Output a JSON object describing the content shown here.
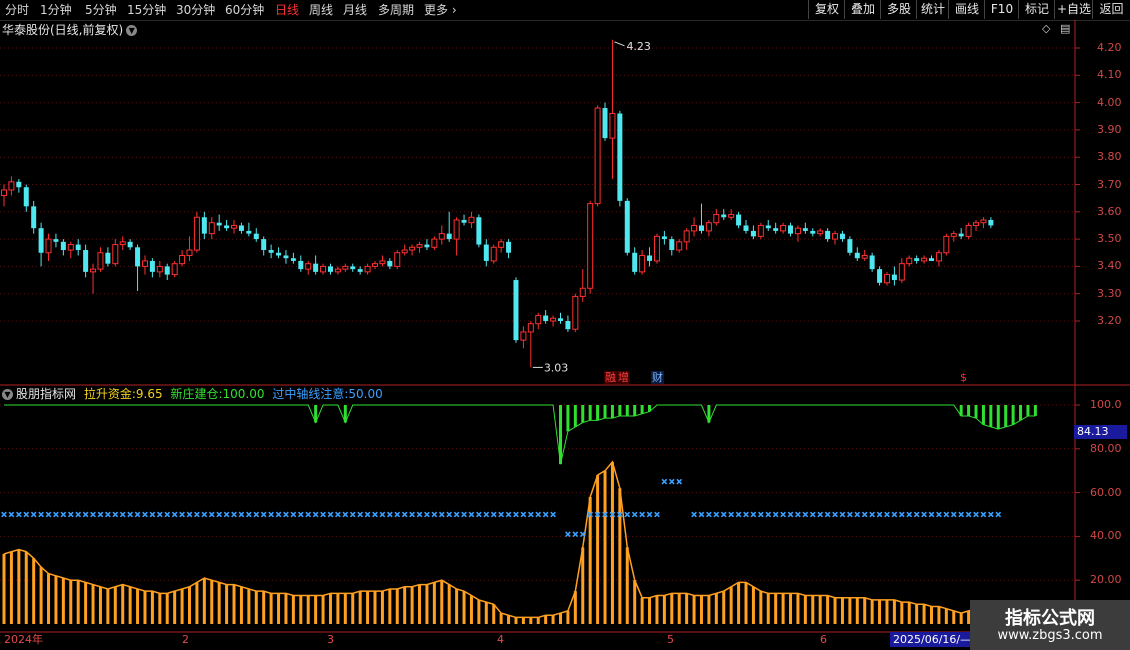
{
  "toolbar": {
    "periods": [
      "分时",
      "1分钟",
      "5分钟",
      "15分钟",
      "30分钟",
      "60分钟",
      "日线",
      "周线",
      "月线",
      "多周期",
      "更多"
    ],
    "active_period": "日线",
    "buttons": [
      "复权",
      "叠加",
      "多股",
      "统计",
      "画线",
      "F10",
      "标记",
      "+自选",
      "返回"
    ]
  },
  "main": {
    "title": "华泰股份(日线,前复权)",
    "price_labels": [
      "4.20",
      "4.10",
      "4.00",
      "3.90",
      "3.80",
      "3.70",
      "3.60",
      "3.50",
      "3.40",
      "3.30",
      "3.20"
    ],
    "high_annotation": "4.23",
    "low_annotation": "3.03",
    "tags": [
      {
        "text": "融",
        "color": "#ff4040"
      },
      {
        "text": "增",
        "color": "#ff4040"
      },
      {
        "text": "财",
        "color": "#7ab0ff"
      },
      {
        "text": "$",
        "color": "#ff3030"
      }
    ]
  },
  "indicator": {
    "name": "股朋指标网",
    "f1_label": "拉升资金:",
    "f1_value": "9.65",
    "f1_color": "#f0d020",
    "f2_label": "新庄建仓:",
    "f2_value": "100.00",
    "f2_color": "#30e030",
    "f3_label": "过中轴线注意:",
    "f3_value": "50.00",
    "f3_color": "#3aa0ff",
    "y_labels": [
      "100.0",
      "80.00",
      "60.00",
      "40.00",
      "20.00"
    ],
    "current_value": "84.13"
  },
  "date_axis": {
    "months": [
      "2024年",
      "2",
      "3",
      "4",
      "5",
      "6"
    ],
    "cursor_date": "2025/06/16/—"
  },
  "watermark": {
    "line1": "指标公式网",
    "line2": "www.zbgs3.com"
  },
  "colors": {
    "up": "#ff3030",
    "down": "#50e8f0",
    "bar_orange": "#ffa020",
    "green": "#30e030",
    "blue": "#3aa0ff"
  },
  "chart_data": [
    {
      "type": "candlestick",
      "ylim": [
        3.03,
        4.23
      ],
      "bars": [
        [
          3.66,
          3.7,
          3.62,
          3.68
        ],
        [
          3.68,
          3.73,
          3.66,
          3.71
        ],
        [
          3.71,
          3.72,
          3.67,
          3.69
        ],
        [
          3.69,
          3.7,
          3.6,
          3.62
        ],
        [
          3.62,
          3.64,
          3.52,
          3.54
        ],
        [
          3.54,
          3.56,
          3.4,
          3.45
        ],
        [
          3.45,
          3.52,
          3.42,
          3.5
        ],
        [
          3.5,
          3.52,
          3.47,
          3.49
        ],
        [
          3.49,
          3.5,
          3.44,
          3.46
        ],
        [
          3.46,
          3.49,
          3.43,
          3.48
        ],
        [
          3.48,
          3.5,
          3.44,
          3.46
        ],
        [
          3.46,
          3.48,
          3.36,
          3.38
        ],
        [
          3.38,
          3.41,
          3.3,
          3.39
        ],
        [
          3.39,
          3.47,
          3.38,
          3.45
        ],
        [
          3.45,
          3.47,
          3.4,
          3.41
        ],
        [
          3.41,
          3.5,
          3.4,
          3.48
        ],
        [
          3.48,
          3.51,
          3.46,
          3.49
        ],
        [
          3.49,
          3.5,
          3.46,
          3.47
        ],
        [
          3.47,
          3.48,
          3.31,
          3.4
        ],
        [
          3.4,
          3.44,
          3.37,
          3.42
        ],
        [
          3.42,
          3.43,
          3.36,
          3.38
        ],
        [
          3.38,
          3.42,
          3.36,
          3.4
        ],
        [
          3.4,
          3.41,
          3.35,
          3.37
        ],
        [
          3.37,
          3.42,
          3.36,
          3.41
        ],
        [
          3.41,
          3.46,
          3.4,
          3.44
        ],
        [
          3.44,
          3.51,
          3.42,
          3.46
        ],
        [
          3.46,
          3.6,
          3.45,
          3.58
        ],
        [
          3.58,
          3.6,
          3.5,
          3.52
        ],
        [
          3.52,
          3.58,
          3.5,
          3.56
        ],
        [
          3.56,
          3.59,
          3.53,
          3.55
        ],
        [
          3.55,
          3.57,
          3.53,
          3.54
        ],
        [
          3.54,
          3.57,
          3.52,
          3.55
        ],
        [
          3.55,
          3.56,
          3.52,
          3.53
        ],
        [
          3.53,
          3.56,
          3.51,
          3.52
        ],
        [
          3.52,
          3.54,
          3.49,
          3.5
        ],
        [
          3.5,
          3.51,
          3.44,
          3.46
        ],
        [
          3.46,
          3.48,
          3.43,
          3.45
        ],
        [
          3.45,
          3.47,
          3.43,
          3.44
        ],
        [
          3.44,
          3.46,
          3.41,
          3.43
        ],
        [
          3.43,
          3.45,
          3.41,
          3.42
        ],
        [
          3.42,
          3.44,
          3.38,
          3.39
        ],
        [
          3.39,
          3.42,
          3.37,
          3.41
        ],
        [
          3.41,
          3.44,
          3.37,
          3.38
        ],
        [
          3.38,
          3.41,
          3.37,
          3.4
        ],
        [
          3.4,
          3.41,
          3.37,
          3.38
        ],
        [
          3.38,
          3.4,
          3.37,
          3.39
        ],
        [
          3.39,
          3.41,
          3.38,
          3.4
        ],
        [
          3.4,
          3.41,
          3.38,
          3.39
        ],
        [
          3.39,
          3.4,
          3.37,
          3.38
        ],
        [
          3.38,
          3.41,
          3.37,
          3.4
        ],
        [
          3.4,
          3.42,
          3.39,
          3.41
        ],
        [
          3.41,
          3.44,
          3.4,
          3.42
        ],
        [
          3.42,
          3.43,
          3.39,
          3.4
        ],
        [
          3.4,
          3.46,
          3.39,
          3.45
        ],
        [
          3.45,
          3.48,
          3.44,
          3.46
        ],
        [
          3.46,
          3.48,
          3.44,
          3.47
        ],
        [
          3.47,
          3.49,
          3.45,
          3.48
        ],
        [
          3.48,
          3.5,
          3.46,
          3.47
        ],
        [
          3.47,
          3.51,
          3.46,
          3.5
        ],
        [
          3.5,
          3.55,
          3.48,
          3.52
        ],
        [
          3.52,
          3.6,
          3.49,
          3.5
        ],
        [
          3.5,
          3.58,
          3.44,
          3.57
        ],
        [
          3.57,
          3.59,
          3.55,
          3.56
        ],
        [
          3.56,
          3.6,
          3.54,
          3.58
        ],
        [
          3.58,
          3.59,
          3.47,
          3.48
        ],
        [
          3.48,
          3.5,
          3.4,
          3.42
        ],
        [
          3.42,
          3.48,
          3.41,
          3.47
        ],
        [
          3.47,
          3.5,
          3.45,
          3.49
        ],
        [
          3.49,
          3.5,
          3.43,
          3.45
        ],
        [
          3.35,
          3.36,
          3.12,
          3.13
        ],
        [
          3.13,
          3.18,
          3.1,
          3.16
        ],
        [
          3.16,
          3.2,
          3.03,
          3.19
        ],
        [
          3.19,
          3.23,
          3.17,
          3.22
        ],
        [
          3.22,
          3.24,
          3.19,
          3.2
        ],
        [
          3.2,
          3.22,
          3.18,
          3.21
        ],
        [
          3.21,
          3.23,
          3.19,
          3.2
        ],
        [
          3.2,
          3.22,
          3.16,
          3.17
        ],
        [
          3.17,
          3.3,
          3.16,
          3.29
        ],
        [
          3.29,
          3.39,
          3.27,
          3.32
        ],
        [
          3.32,
          3.64,
          3.3,
          3.63
        ],
        [
          3.63,
          3.99,
          3.62,
          3.98
        ],
        [
          3.98,
          4.0,
          3.86,
          3.87
        ],
        [
          3.87,
          4.23,
          3.72,
          3.96
        ],
        [
          3.96,
          3.97,
          3.62,
          3.64
        ],
        [
          3.64,
          3.65,
          3.44,
          3.45
        ],
        [
          3.45,
          3.47,
          3.37,
          3.38
        ],
        [
          3.38,
          3.46,
          3.37,
          3.44
        ],
        [
          3.44,
          3.47,
          3.4,
          3.42
        ],
        [
          3.42,
          3.52,
          3.41,
          3.51
        ],
        [
          3.51,
          3.53,
          3.48,
          3.5
        ],
        [
          3.5,
          3.51,
          3.44,
          3.46
        ],
        [
          3.46,
          3.5,
          3.45,
          3.49
        ],
        [
          3.49,
          3.54,
          3.46,
          3.53
        ],
        [
          3.53,
          3.58,
          3.51,
          3.55
        ],
        [
          3.55,
          3.63,
          3.52,
          3.53
        ],
        [
          3.53,
          3.57,
          3.51,
          3.56
        ],
        [
          3.56,
          3.61,
          3.55,
          3.59
        ],
        [
          3.59,
          3.61,
          3.57,
          3.58
        ],
        [
          3.58,
          3.61,
          3.57,
          3.59
        ],
        [
          3.59,
          3.6,
          3.54,
          3.55
        ],
        [
          3.55,
          3.57,
          3.52,
          3.53
        ],
        [
          3.53,
          3.55,
          3.5,
          3.51
        ],
        [
          3.51,
          3.56,
          3.5,
          3.55
        ],
        [
          3.55,
          3.57,
          3.53,
          3.54
        ],
        [
          3.54,
          3.56,
          3.52,
          3.53
        ],
        [
          3.53,
          3.56,
          3.52,
          3.55
        ],
        [
          3.55,
          3.56,
          3.51,
          3.52
        ],
        [
          3.52,
          3.55,
          3.49,
          3.54
        ],
        [
          3.54,
          3.56,
          3.52,
          3.53
        ],
        [
          3.53,
          3.54,
          3.51,
          3.52
        ],
        [
          3.52,
          3.54,
          3.51,
          3.53
        ],
        [
          3.53,
          3.54,
          3.49,
          3.5
        ],
        [
          3.5,
          3.53,
          3.48,
          3.52
        ],
        [
          3.52,
          3.53,
          3.49,
          3.5
        ],
        [
          3.5,
          3.51,
          3.44,
          3.45
        ],
        [
          3.45,
          3.47,
          3.42,
          3.43
        ],
        [
          3.43,
          3.46,
          3.42,
          3.44
        ],
        [
          3.44,
          3.45,
          3.38,
          3.39
        ],
        [
          3.39,
          3.4,
          3.33,
          3.34
        ],
        [
          3.34,
          3.38,
          3.33,
          3.37
        ],
        [
          3.37,
          3.4,
          3.33,
          3.35
        ],
        [
          3.35,
          3.43,
          3.34,
          3.41
        ],
        [
          3.41,
          3.44,
          3.4,
          3.43
        ],
        [
          3.43,
          3.44,
          3.41,
          3.42
        ],
        [
          3.42,
          3.44,
          3.41,
          3.43
        ],
        [
          3.43,
          3.44,
          3.42,
          3.42
        ],
        [
          3.42,
          3.46,
          3.4,
          3.45
        ],
        [
          3.45,
          3.52,
          3.44,
          3.51
        ],
        [
          3.51,
          3.53,
          3.49,
          3.52
        ],
        [
          3.52,
          3.54,
          3.5,
          3.51
        ],
        [
          3.51,
          3.56,
          3.5,
          3.55
        ],
        [
          3.55,
          3.57,
          3.53,
          3.56
        ],
        [
          3.56,
          3.58,
          3.54,
          3.57
        ],
        [
          3.57,
          3.58,
          3.54,
          3.55
        ]
      ]
    },
    {
      "type": "bar",
      "name": "拉升资金",
      "ylim": [
        0,
        100
      ],
      "values": [
        32,
        33,
        34,
        33,
        30,
        26,
        23,
        22,
        21,
        20,
        20,
        19,
        18,
        17,
        16,
        17,
        18,
        17,
        16,
        15,
        15,
        14,
        14,
        15,
        16,
        17,
        19,
        21,
        20,
        19,
        18,
        18,
        17,
        16,
        15,
        15,
        14,
        14,
        14,
        13,
        13,
        13,
        13,
        13,
        14,
        14,
        14,
        14,
        15,
        15,
        15,
        15,
        16,
        16,
        17,
        17,
        18,
        18,
        19,
        20,
        18,
        16,
        15,
        13,
        11,
        10,
        9,
        5,
        4,
        3,
        3,
        3,
        3,
        4,
        4,
        5,
        6,
        15,
        35,
        58,
        68,
        70,
        74,
        62,
        35,
        20,
        12,
        12,
        13,
        13,
        14,
        14,
        14,
        13,
        13,
        13,
        14,
        15,
        17,
        19,
        19,
        17,
        15,
        14,
        14,
        14,
        14,
        14,
        13,
        13,
        13,
        13,
        12,
        12,
        12,
        12,
        12,
        11,
        11,
        11,
        11,
        10,
        10,
        9,
        9,
        8,
        8,
        7,
        6,
        5,
        6,
        7,
        8,
        8,
        8
      ]
    },
    {
      "type": "line",
      "name": "新庄建仓",
      "ylim": [
        0,
        100
      ],
      "dips": [
        {
          "i": 42,
          "v": 92
        },
        {
          "i": 46,
          "v": 92
        },
        {
          "i": 75,
          "v": 73
        },
        {
          "i": 76,
          "v": 88
        },
        {
          "i": 77,
          "v": 90
        },
        {
          "i": 78,
          "v": 92
        },
        {
          "i": 79,
          "v": 93
        },
        {
          "i": 80,
          "v": 93
        },
        {
          "i": 81,
          "v": 94
        },
        {
          "i": 82,
          "v": 94
        },
        {
          "i": 83,
          "v": 95
        },
        {
          "i": 84,
          "v": 95
        },
        {
          "i": 85,
          "v": 95
        },
        {
          "i": 86,
          "v": 96
        },
        {
          "i": 87,
          "v": 97
        },
        {
          "i": 95,
          "v": 92
        },
        {
          "i": 129,
          "v": 95
        },
        {
          "i": 130,
          "v": 95
        },
        {
          "i": 131,
          "v": 94
        },
        {
          "i": 132,
          "v": 91
        },
        {
          "i": 133,
          "v": 90
        },
        {
          "i": 134,
          "v": 89
        },
        {
          "i": 135,
          "v": 90
        },
        {
          "i": 136,
          "v": 91
        },
        {
          "i": 137,
          "v": 93
        },
        {
          "i": 138,
          "v": 95
        },
        {
          "i": 139,
          "v": 95
        }
      ]
    },
    {
      "type": "scatter",
      "name": "过中轴线注意",
      "ylim": [
        0,
        100
      ],
      "main_level": 50,
      "gaps": [
        [
          75,
          78
        ],
        [
          89,
          92
        ]
      ],
      "low_points": [
        {
          "from": 76,
          "to": 78,
          "v": 41
        }
      ],
      "high_points": [
        {
          "from": 89,
          "to": 91,
          "v": 65
        }
      ]
    }
  ]
}
